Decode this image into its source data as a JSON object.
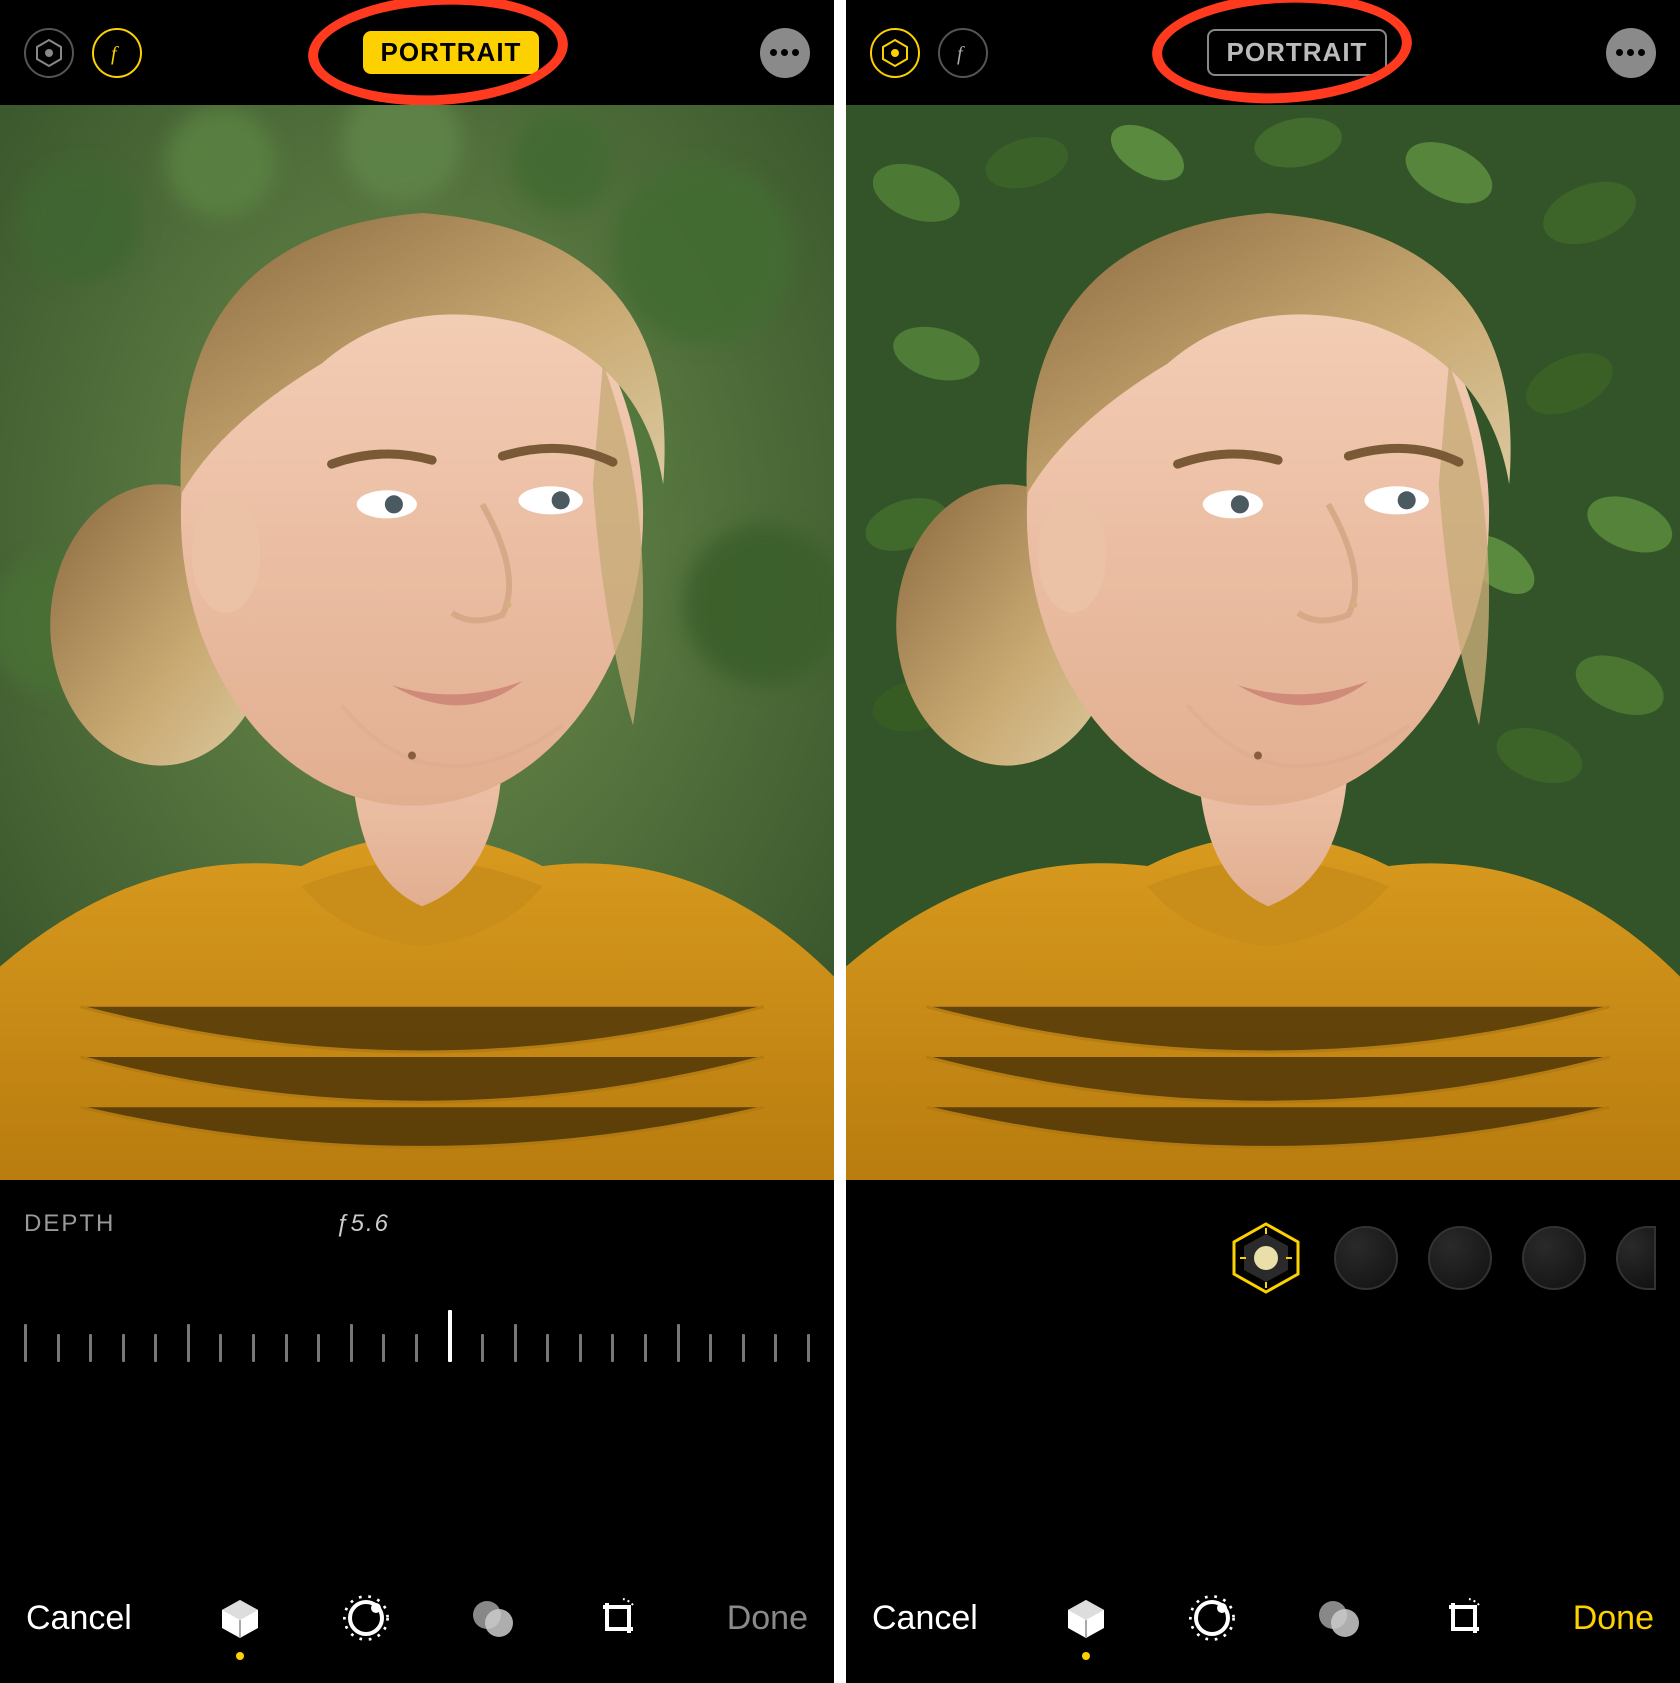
{
  "left": {
    "topbar": {
      "lighting_icon": "portrait-lighting-icon",
      "aperture_icon": "aperture-f-icon",
      "badge_label": "PORTRAIT",
      "badge_state": "on",
      "more_icon": "more-icon"
    },
    "depth": {
      "label": "DEPTH",
      "value": "ƒ5.6"
    },
    "toolbar": {
      "cancel": "Cancel",
      "done": "Done",
      "done_state": "inactive",
      "tools": [
        "lighting-cube-icon",
        "adjust-dial-icon",
        "filters-circles-icon",
        "crop-rotate-icon"
      ],
      "selected_tool_index": 0
    },
    "annotation": "red-circle"
  },
  "right": {
    "topbar": {
      "lighting_icon": "portrait-lighting-icon",
      "aperture_icon": "aperture-f-icon",
      "badge_label": "PORTRAIT",
      "badge_state": "off",
      "more_icon": "more-icon"
    },
    "lighting_carousel": {
      "selected_index": 0,
      "options_visible": 5
    },
    "toolbar": {
      "cancel": "Cancel",
      "done": "Done",
      "done_state": "active",
      "tools": [
        "lighting-cube-icon",
        "adjust-dial-icon",
        "filters-circles-icon",
        "crop-rotate-icon"
      ],
      "selected_tool_index": 0
    },
    "annotation": "red-circle"
  },
  "colors": {
    "accent": "#fdd100",
    "annotation": "#ff3a1f"
  }
}
